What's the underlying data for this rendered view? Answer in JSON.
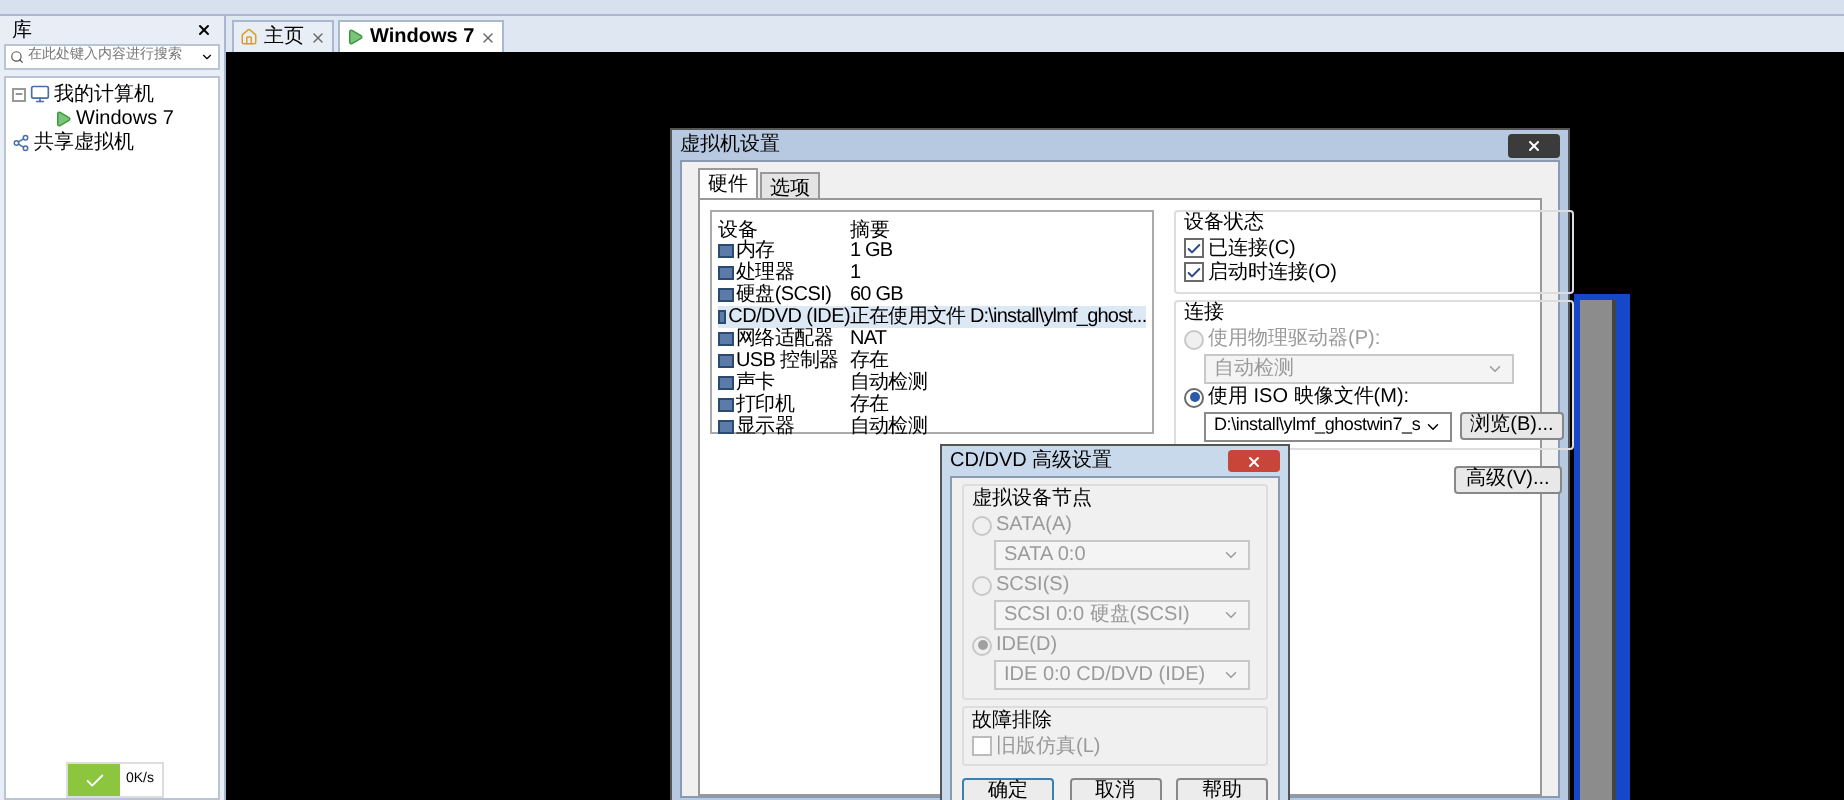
{
  "sidebar": {
    "title": "库",
    "search": {
      "placeholder": "在此处键入内容进行搜索"
    },
    "tree": [
      {
        "label": "我的计算机",
        "expanded": true,
        "children": [
          {
            "label": "Windows 7"
          }
        ]
      },
      {
        "label": "共享虚拟机"
      }
    ],
    "speed_widget": {
      "reading": "0K/s"
    }
  },
  "tabs": [
    {
      "label": "主页",
      "selected": false
    },
    {
      "label": "Windows 7",
      "selected": true
    }
  ],
  "settings_dialog": {
    "title": "虚拟机设置",
    "tabs": [
      {
        "label": "硬件",
        "selected": true
      },
      {
        "label": "选项",
        "selected": false
      }
    ],
    "device_table": {
      "columns": [
        "设备",
        "摘要"
      ],
      "rows": [
        {
          "device": "内存",
          "summary": "1 GB",
          "selected": false
        },
        {
          "device": "处理器",
          "summary": "1",
          "selected": false
        },
        {
          "device": "硬盘(SCSI)",
          "summary": "60 GB",
          "selected": false
        },
        {
          "device": "CD/DVD (IDE)",
          "summary": "正在使用文件 D:\\install\\ylmf_ghost...",
          "selected": true
        },
        {
          "device": "网络适配器",
          "summary": "NAT",
          "selected": false
        },
        {
          "device": "USB 控制器",
          "summary": "存在",
          "selected": false
        },
        {
          "device": "声卡",
          "summary": "自动检测",
          "selected": false
        },
        {
          "device": "打印机",
          "summary": "存在",
          "selected": false
        },
        {
          "device": "显示器",
          "summary": "自动检测",
          "selected": false
        }
      ]
    },
    "device_status": {
      "title": "设备状态",
      "options": [
        {
          "label": "已连接(C)",
          "checked": true
        },
        {
          "label": "启动时连接(O)",
          "checked": true
        }
      ]
    },
    "connection": {
      "title": "连接",
      "physical": {
        "label": "使用物理驱动器(P):",
        "selected": false,
        "disabled": true,
        "value": "自动检测"
      },
      "iso": {
        "label": "使用 ISO 映像文件(M):",
        "selected": true,
        "disabled": false,
        "value": "D:\\install\\ylmf_ghostwin7_s"
      },
      "browse_button": "浏览(B)..."
    },
    "advanced_button": "高级(V)..."
  },
  "advanced_dialog": {
    "title": "CD/DVD 高级设置",
    "node_group": {
      "title": "虚拟设备节点",
      "options": [
        {
          "label": "SATA(A)",
          "selected": false,
          "value": "SATA 0:0"
        },
        {
          "label": "SCSI(S)",
          "selected": false,
          "value": "SCSI 0:0   硬盘(SCSI)"
        },
        {
          "label": "IDE(D)",
          "selected": true,
          "value": "IDE 0:0   CD/DVD (IDE)"
        }
      ]
    },
    "troubleshoot": {
      "title": "故障排除",
      "option": {
        "label": "旧版仿真(L)",
        "checked": false
      }
    },
    "buttons": [
      "确定",
      "取消",
      "帮助"
    ]
  }
}
